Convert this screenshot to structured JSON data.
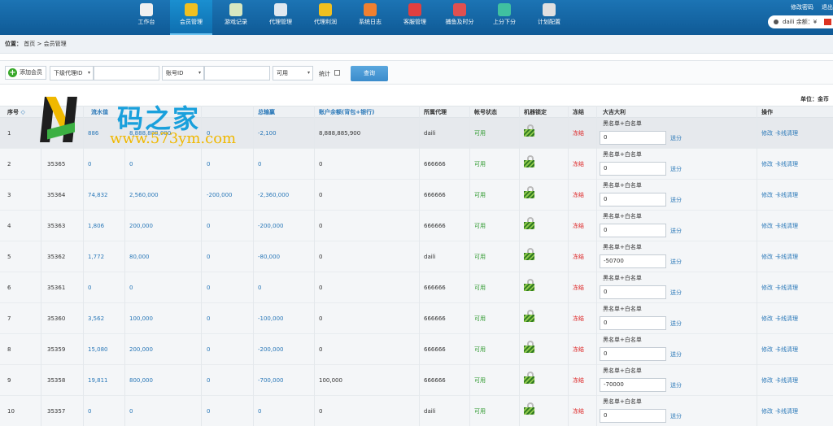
{
  "nav": {
    "items": [
      {
        "label": "工作台",
        "icon": "home-icon",
        "color": "#f0f0f0"
      },
      {
        "label": "会员管理",
        "icon": "users-icon",
        "color": "#f0c020"
      },
      {
        "label": "游戏记录",
        "icon": "pencil-icon",
        "color": "#d8e8c0"
      },
      {
        "label": "代理管理",
        "icon": "monitor-icon",
        "color": "#e0e8f0"
      },
      {
        "label": "代理利润",
        "icon": "money-bag-icon",
        "color": "#f0c020"
      },
      {
        "label": "系统日志",
        "icon": "group-icon",
        "color": "#f08030"
      },
      {
        "label": "客服管理",
        "icon": "group-icon",
        "color": "#e04040"
      },
      {
        "label": "捕鱼及时分",
        "icon": "group-icon",
        "color": "#e05050"
      },
      {
        "label": "上分下分",
        "icon": "arrow-icon",
        "color": "#40c0a0"
      },
      {
        "label": "计划配置",
        "icon": "gears-icon",
        "color": "#e0e0e0"
      }
    ],
    "active_index": 1
  },
  "top_right": {
    "change_password": "修改密码",
    "logout": "退出",
    "user_text": "daili 余额：¥"
  },
  "breadcrumb": {
    "label": "位置：",
    "home": "首页",
    "sep": ">",
    "current": "会员管理"
  },
  "toolbar": {
    "add_member": "添加会员",
    "sub_agent_select": "下级代理ID",
    "account_select": "账号ID",
    "status_select": "可用",
    "stats_label": "统计",
    "query_button": "查询"
  },
  "unit_label": "单位：金币",
  "table": {
    "headers": {
      "seq": "序号",
      "sort_ico": "◇",
      "water": "流水值",
      "total_loss": "总输赢",
      "balance": "账户余额(背包+银行)",
      "agent": "所属代理",
      "account_status": "帐号状态",
      "machine_lock": "机器锁定",
      "freeze": "冻结",
      "big_win": "大吉大利",
      "actions": "操作"
    },
    "list_label": "黑名单+白名单",
    "send_label": "送分",
    "edit_label": "修改",
    "offline_label": "卡线清理",
    "rows": [
      {
        "seq": "1",
        "id": "",
        "water": "886",
        "score": "8,888,888,000",
        "add": "0",
        "total": "-2,100",
        "balance": "8,888,885,900",
        "agent": "daili",
        "status": "可用",
        "freeze": "冻结",
        "dd": "0"
      },
      {
        "seq": "2",
        "id": "35365",
        "water": "0",
        "score": "0",
        "add": "0",
        "total": "0",
        "balance": "0",
        "agent": "666666",
        "status": "可用",
        "freeze": "冻结",
        "dd": "0"
      },
      {
        "seq": "3",
        "id": "35364",
        "water": "74,832",
        "score": "2,560,000",
        "add": "-200,000",
        "total": "-2,360,000",
        "balance": "0",
        "agent": "666666",
        "status": "可用",
        "freeze": "冻结",
        "dd": "0"
      },
      {
        "seq": "4",
        "id": "35363",
        "water": "1,806",
        "score": "200,000",
        "add": "0",
        "total": "-200,000",
        "balance": "0",
        "agent": "666666",
        "status": "可用",
        "freeze": "冻结",
        "dd": "0"
      },
      {
        "seq": "5",
        "id": "35362",
        "water": "1,772",
        "score": "80,000",
        "add": "0",
        "total": "-80,000",
        "balance": "0",
        "agent": "daili",
        "status": "可用",
        "freeze": "冻结",
        "dd": "-50700"
      },
      {
        "seq": "6",
        "id": "35361",
        "water": "0",
        "score": "0",
        "add": "0",
        "total": "0",
        "balance": "0",
        "agent": "666666",
        "status": "可用",
        "freeze": "冻结",
        "dd": "0"
      },
      {
        "seq": "7",
        "id": "35360",
        "water": "3,562",
        "score": "100,000",
        "add": "0",
        "total": "-100,000",
        "balance": "0",
        "agent": "666666",
        "status": "可用",
        "freeze": "冻结",
        "dd": "0"
      },
      {
        "seq": "8",
        "id": "35359",
        "water": "15,080",
        "score": "200,000",
        "add": "0",
        "total": "-200,000",
        "balance": "0",
        "agent": "666666",
        "status": "可用",
        "freeze": "冻结",
        "dd": "0"
      },
      {
        "seq": "9",
        "id": "35358",
        "water": "19,811",
        "score": "800,000",
        "add": "0",
        "total": "-700,000",
        "balance": "100,000",
        "agent": "666666",
        "status": "可用",
        "freeze": "冻结",
        "dd": "-70000"
      },
      {
        "seq": "10",
        "id": "35357",
        "water": "0",
        "score": "0",
        "add": "0",
        "total": "0",
        "balance": "0",
        "agent": "daili",
        "status": "可用",
        "freeze": "冻结",
        "dd": "0"
      }
    ]
  },
  "watermark": {
    "cn": "码之家",
    "url": "www.573ym.com"
  }
}
